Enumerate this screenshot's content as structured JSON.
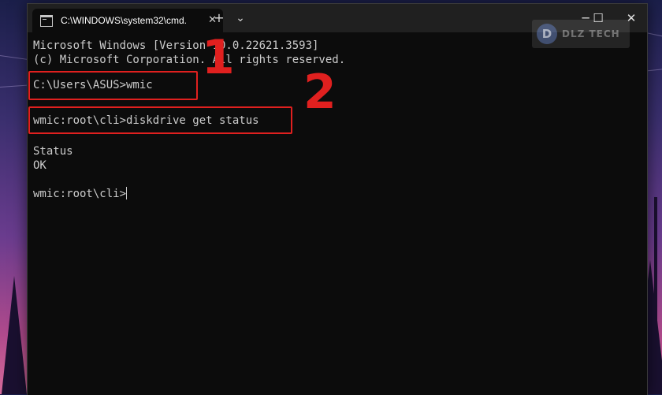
{
  "window": {
    "tab_title": "C:\\WINDOWS\\system32\\cmd.",
    "tab_close": "✕",
    "new_tab": "+",
    "dropdown": "⌄",
    "minimize": "─",
    "maximize": "☐",
    "close": "✕"
  },
  "terminal": {
    "lines": [
      "Microsoft Windows [Version 10.0.22621.3593]",
      "(c) Microsoft Corporation. All rights reserved.",
      "C:\\Users\\ASUS>wmic",
      "wmic:root\\cli>diskdrive get status",
      "Status",
      "OK",
      "wmic:root\\cli>"
    ]
  },
  "annotations": {
    "step1": "1",
    "step2": "2",
    "highlight_color": "#e0201f"
  },
  "watermark": {
    "logo": "D",
    "text": "DLZ TECH"
  }
}
